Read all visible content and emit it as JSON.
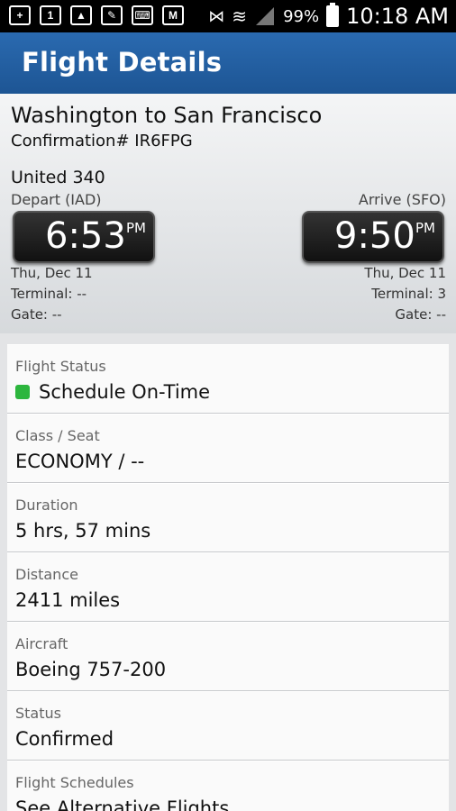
{
  "status_bar": {
    "battery": "99%",
    "time": "10:18 AM"
  },
  "app_bar": {
    "title": "Flight Details"
  },
  "flight": {
    "route": "Washington to San Francisco",
    "confirmation": "Confirmation# IR6FPG",
    "flight_number": "United 340",
    "depart": {
      "label": "Depart (IAD)",
      "time": "6:53",
      "ampm": "PM",
      "date": "Thu, Dec 11",
      "terminal": "Terminal: --",
      "gate": "Gate: --"
    },
    "arrive": {
      "label": "Arrive (SFO)",
      "time": "9:50",
      "ampm": "PM",
      "date": "Thu, Dec 11",
      "terminal": "Terminal: 3",
      "gate": "Gate: --"
    }
  },
  "details": [
    {
      "label": "Flight Status",
      "value": "Schedule On-Time",
      "status_color": "#2db63e"
    },
    {
      "label": "Class / Seat",
      "value": "ECONOMY / --"
    },
    {
      "label": "Duration",
      "value": "5 hrs, 57 mins"
    },
    {
      "label": "Distance",
      "value": "2411 miles"
    },
    {
      "label": "Aircraft",
      "value": "Boeing 757-200"
    },
    {
      "label": "Status",
      "value": "Confirmed"
    },
    {
      "label": "Flight Schedules",
      "value": "See Alternative Flights"
    }
  ]
}
